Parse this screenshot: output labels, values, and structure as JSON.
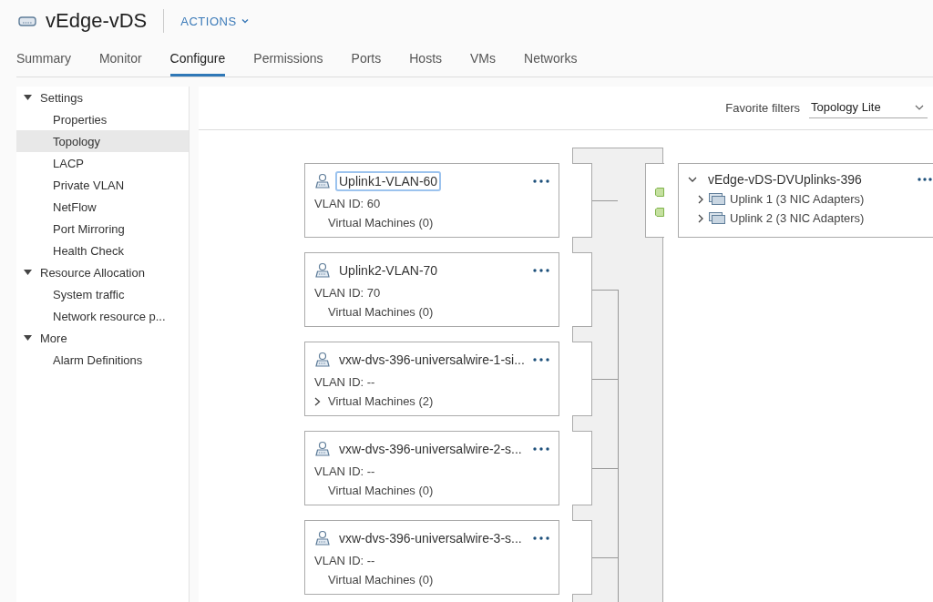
{
  "header": {
    "title": "vEdge-vDS",
    "actions": "ACTIONS"
  },
  "tabs": [
    {
      "label": "Summary",
      "selected": false
    },
    {
      "label": "Monitor",
      "selected": false
    },
    {
      "label": "Configure",
      "selected": true
    },
    {
      "label": "Permissions",
      "selected": false
    },
    {
      "label": "Ports",
      "selected": false
    },
    {
      "label": "Hosts",
      "selected": false
    },
    {
      "label": "VMs",
      "selected": false
    },
    {
      "label": "Networks",
      "selected": false
    }
  ],
  "sidebar": {
    "sections": [
      {
        "label": "Settings",
        "expanded": true,
        "children": [
          {
            "label": "Properties",
            "selected": false
          },
          {
            "label": "Topology",
            "selected": true
          },
          {
            "label": "LACP",
            "selected": false
          },
          {
            "label": "Private VLAN",
            "selected": false
          },
          {
            "label": "NetFlow",
            "selected": false
          },
          {
            "label": "Port Mirroring",
            "selected": false
          },
          {
            "label": "Health Check",
            "selected": false
          }
        ]
      },
      {
        "label": "Resource Allocation",
        "expanded": true,
        "children": [
          {
            "label": "System traffic",
            "selected": false
          },
          {
            "label": "Network resource p...",
            "selected": false
          }
        ]
      },
      {
        "label": "More",
        "expanded": true,
        "children": [
          {
            "label": "Alarm Definitions",
            "selected": false
          }
        ]
      }
    ]
  },
  "favorite_filters": {
    "label": "Favorite filters",
    "value": "Topology Lite"
  },
  "port_groups": [
    {
      "name": "Uplink1-VLAN-60",
      "focused": true,
      "vlan": "VLAN ID: 60",
      "vms": "Virtual Machines (0)",
      "expandable": false
    },
    {
      "name": "Uplink2-VLAN-70",
      "focused": false,
      "vlan": "VLAN ID: 70",
      "vms": "Virtual Machines (0)",
      "expandable": false
    },
    {
      "name": "vxw-dvs-396-universalwire-1-si...",
      "focused": false,
      "vlan": "VLAN ID: --",
      "vms": "Virtual Machines (2)",
      "expandable": true
    },
    {
      "name": "vxw-dvs-396-universalwire-2-s...",
      "focused": false,
      "vlan": "VLAN ID: --",
      "vms": "Virtual Machines (0)",
      "expandable": false
    },
    {
      "name": "vxw-dvs-396-universalwire-3-s...",
      "focused": false,
      "vlan": "VLAN ID: --",
      "vms": "Virtual Machines (0)",
      "expandable": false
    }
  ],
  "uplinks": {
    "name": "vEdge-vDS-DVUplinks-396",
    "expanded": true,
    "items": [
      {
        "label": "Uplink 1 (3 NIC Adapters)",
        "expanded": false
      },
      {
        "label": "Uplink 2 (3 NIC Adapters)",
        "expanded": false
      }
    ]
  }
}
